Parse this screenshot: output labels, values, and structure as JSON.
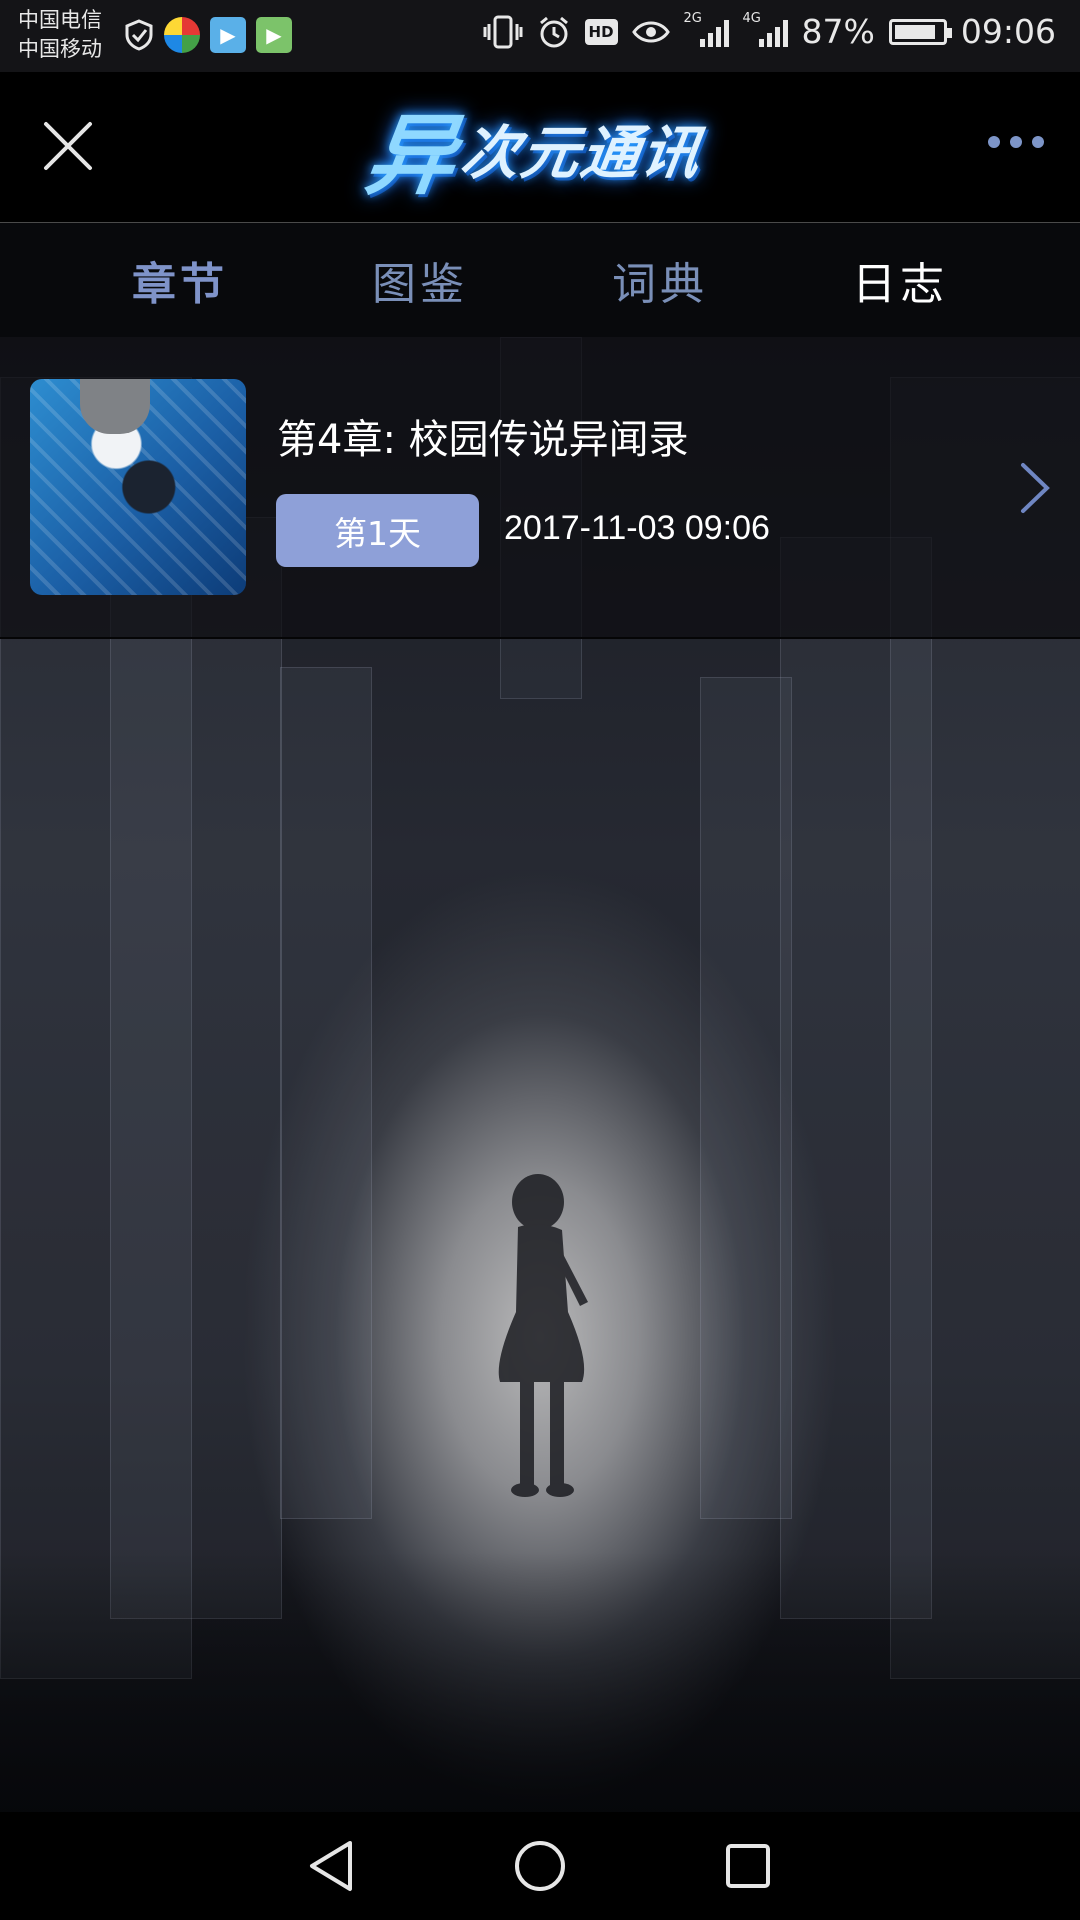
{
  "status_bar": {
    "carrier_1": "中国电信",
    "carrier_2": "中国移动",
    "network_2g": "2G",
    "network_4g": "4G",
    "hd": "HD",
    "battery_percent": "87%",
    "battery_level": 0.87,
    "time": "09:06"
  },
  "header": {
    "logo_text": "异次元通讯",
    "logo_first": "异",
    "logo_rest": "次元通讯"
  },
  "tabs": [
    {
      "label": "章节"
    },
    {
      "label": "图鉴"
    },
    {
      "label": "词典"
    },
    {
      "label": "日志"
    }
  ],
  "chapter": {
    "title": "第4章: 校园传说异闻录",
    "day_badge": "第1天",
    "datetime": "2017-11-03 09:06"
  },
  "colors": {
    "accent": "#8ea0d8",
    "tab_inactive": "#7a8fb8",
    "background": "#0b0d12"
  }
}
